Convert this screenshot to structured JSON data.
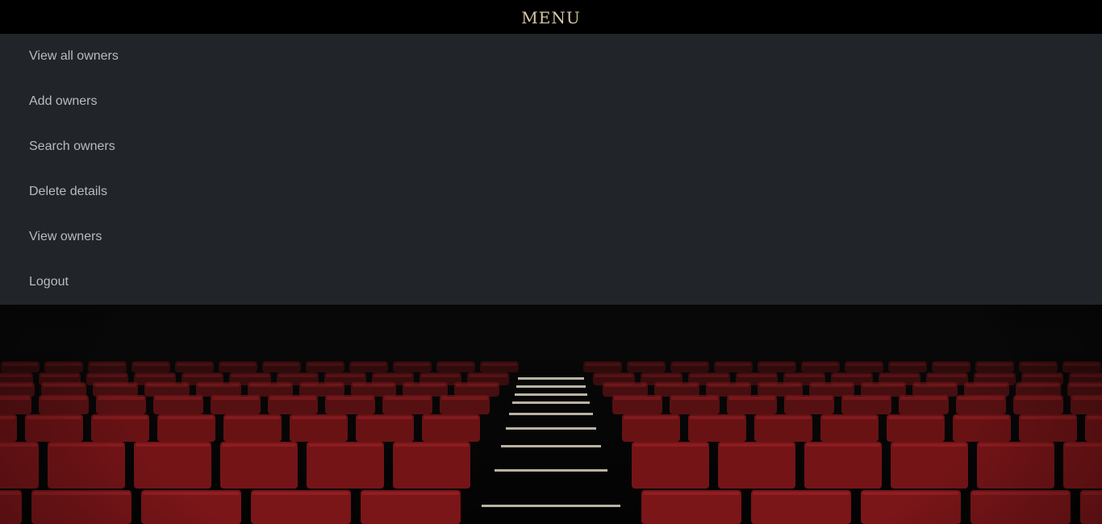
{
  "header": {
    "title": "MENU"
  },
  "menu": {
    "items": [
      {
        "label": "View all owners"
      },
      {
        "label": "Add owners"
      },
      {
        "label": "Search owners"
      },
      {
        "label": "Delete details"
      },
      {
        "label": "View owners"
      },
      {
        "label": "Logout"
      }
    ]
  },
  "background": {
    "subject": "empty cinema auditorium with red seats and lit staircase",
    "colors": {
      "seat_red": "#7a1518",
      "backdrop": "#050505",
      "step_light": "#d9d2bf"
    }
  }
}
